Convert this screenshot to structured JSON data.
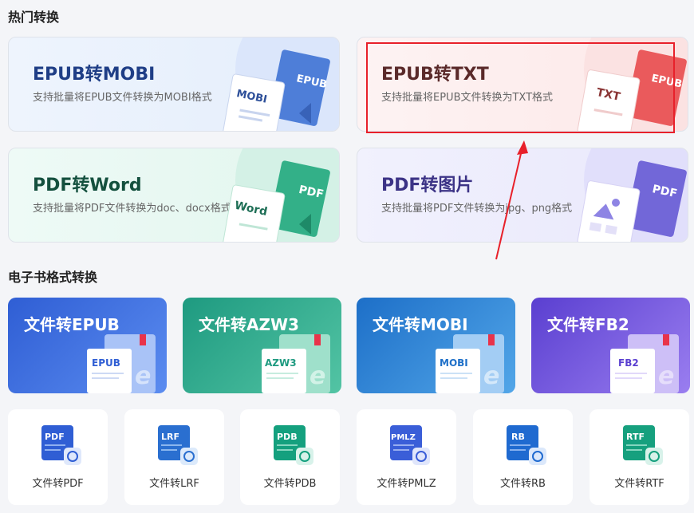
{
  "sections": {
    "hot": "热门转换",
    "ebook": "电子书格式转换"
  },
  "hot_cards": [
    {
      "title": "EPUB转MOBI",
      "desc": "支持批量将EPUB文件转换为MOBI格式",
      "badge": "MOBI",
      "back": "EPUB"
    },
    {
      "title": "EPUB转TXT",
      "desc": "支持批量将EPUB文件转换为TXT格式",
      "badge": "TXT",
      "back": "EPUB"
    },
    {
      "title": "PDF转Word",
      "desc": "支持批量将PDF文件转换为doc、docx格式",
      "badge": "Word",
      "back": "PDF"
    },
    {
      "title": "PDF转图片",
      "desc": "支持批量将PDF文件转换为jpg、png格式",
      "badge": "",
      "back": "PDF"
    }
  ],
  "ebook_cards": [
    {
      "title": "文件转EPUB",
      "badge": "EPUB"
    },
    {
      "title": "文件转AZW3",
      "badge": "AZW3"
    },
    {
      "title": "文件转MOBI",
      "badge": "MOBI"
    },
    {
      "title": "文件转FB2",
      "badge": "FB2"
    }
  ],
  "formats": [
    {
      "label": "文件转PDF",
      "icon_text": "PDF",
      "color": "#2f5ed4"
    },
    {
      "label": "文件转LRF",
      "icon_text": "LRF",
      "color": "#2a6fd0"
    },
    {
      "label": "文件转PDB",
      "icon_text": "PDB",
      "color": "#14a07e"
    },
    {
      "label": "文件转PMLZ",
      "icon_text": "PMLZ",
      "color": "#3a5ed8"
    },
    {
      "label": "文件转RB",
      "icon_text": "RB",
      "color": "#1f6ad0"
    },
    {
      "label": "文件转RTF",
      "icon_text": "RTF",
      "color": "#16a07e"
    }
  ],
  "colors": {
    "highlight": "#e8202a",
    "accent_blue": "#2f5ed4"
  }
}
